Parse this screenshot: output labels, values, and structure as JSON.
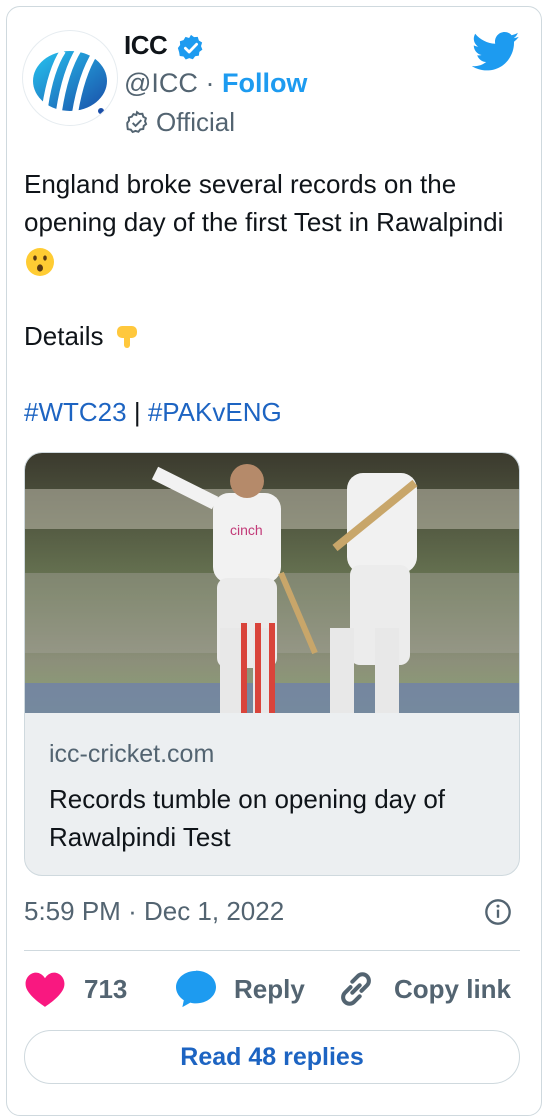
{
  "author": {
    "name": "ICC",
    "handle": "@ICC",
    "separator": "·",
    "follow_label": "Follow",
    "badge_label": "Official",
    "avatar_logo": "icc-stumps-logo"
  },
  "tweet": {
    "lines": [
      "England broke several records on the opening day of the first Test in Rawalpindi"
    ],
    "details_label": "Details",
    "hashtags": [
      "#WTC23",
      "#PAKvENG"
    ],
    "hashtag_separator": "|"
  },
  "link_card": {
    "domain": "icc-cricket.com",
    "title": "Records tumble on opening day of Rawalpindi Test",
    "photo_text": "cinch"
  },
  "meta": {
    "time": "5:59 PM",
    "separator": "·",
    "date": "Dec 1, 2022"
  },
  "actions": {
    "likes": "713",
    "reply_label": "Reply",
    "copy_label": "Copy link"
  },
  "read_replies_label": "Read 48 replies",
  "colors": {
    "accent": "#1d9bf0",
    "link": "#1d64c2",
    "like": "#f91880",
    "muted": "#536471"
  }
}
